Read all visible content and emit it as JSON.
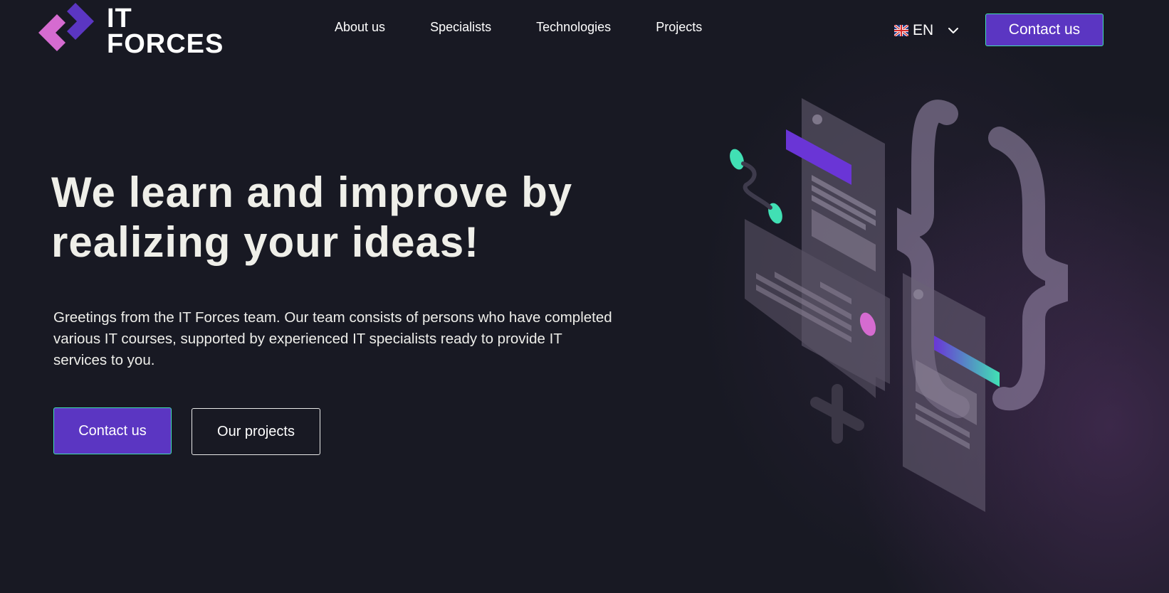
{
  "brand": {
    "line1": "IT",
    "line2": "FORCES",
    "colors": {
      "mark_pink": "#d56bd0",
      "mark_purple": "#5b36c2",
      "accent_green": "#41e0b4",
      "background": "#181923"
    }
  },
  "nav": {
    "items": [
      {
        "label": "About us"
      },
      {
        "label": "Specialists"
      },
      {
        "label": "Technologies"
      },
      {
        "label": "Projects"
      }
    ]
  },
  "language": {
    "selected": "EN",
    "flag_icon": "uk-flag-icon",
    "dropdown_icon": "chevron-down-icon"
  },
  "header": {
    "cta_label": "Contact us"
  },
  "hero": {
    "title": "We learn and improve by realizing your ideas!",
    "description": "Greetings from the IT Forces team. Our team consists of persons who have completed various IT courses, supported by experienced IT specialists ready to provide IT services to you.",
    "primary_button": "Contact us",
    "secondary_button": "Our projects"
  },
  "illustration": {
    "icon": "code-braces-isometric-illustration"
  }
}
